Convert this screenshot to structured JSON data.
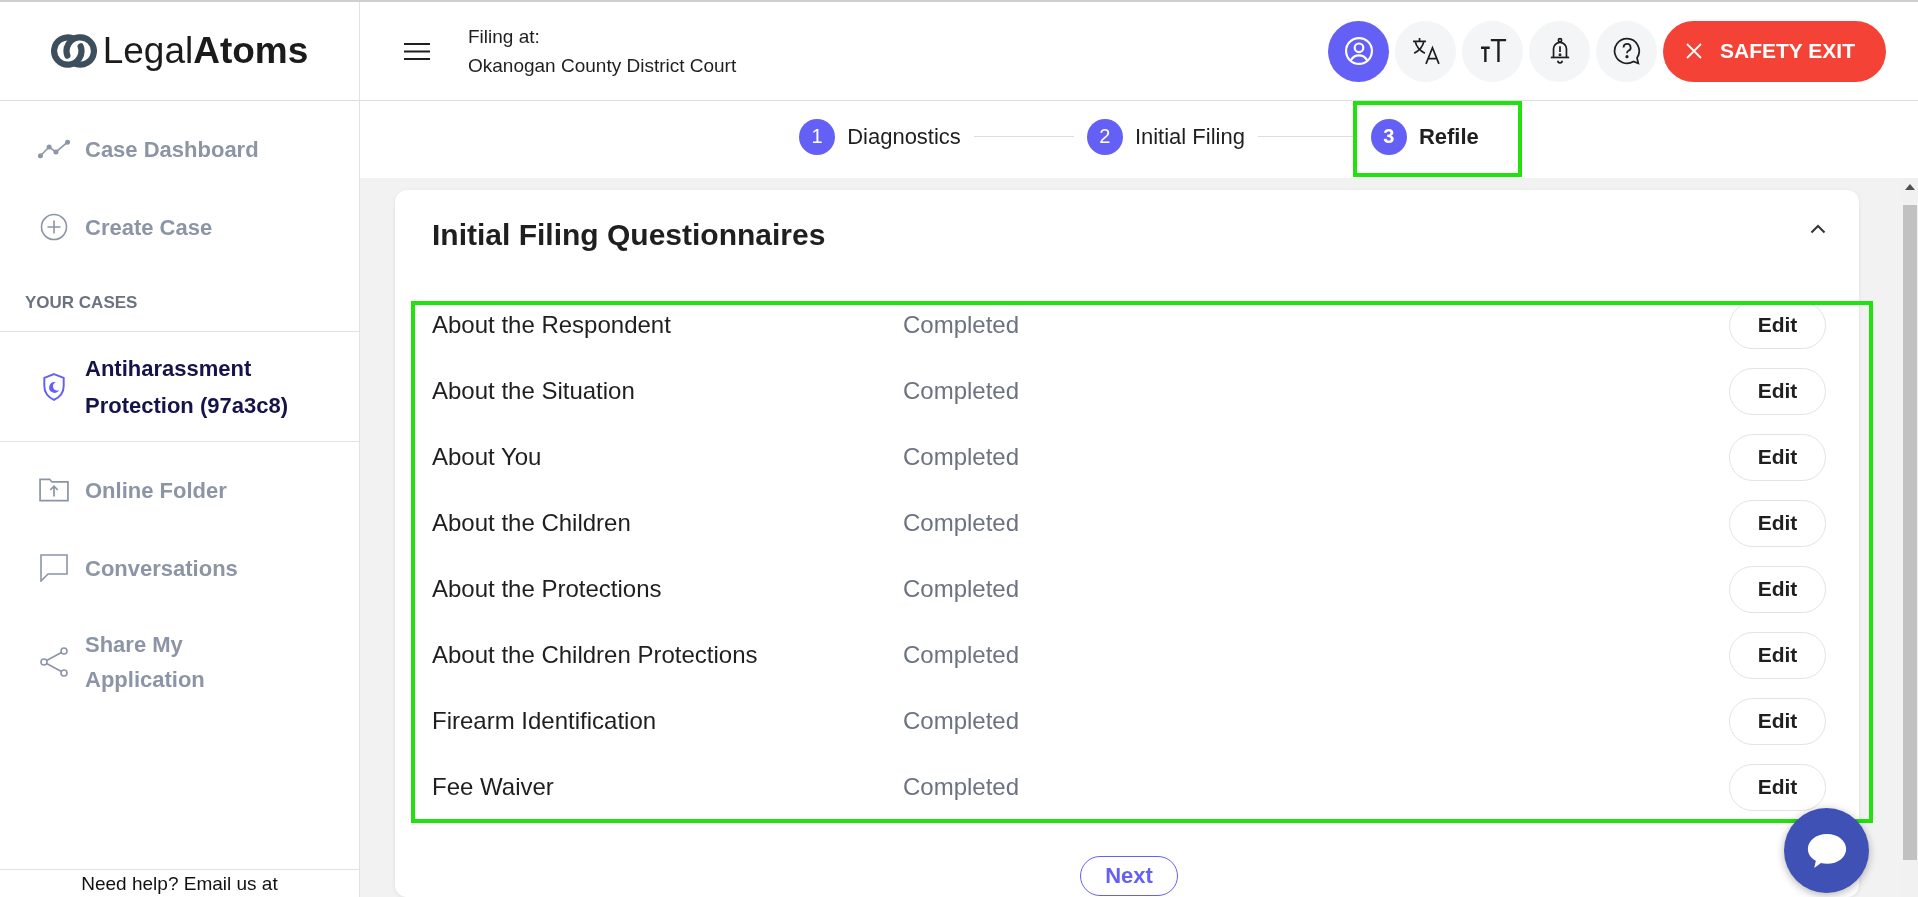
{
  "logo": {
    "text": "Legal**Atoms**"
  },
  "sidebar": {
    "nav": [
      {
        "kind": "dashboard",
        "label": "Case Dashboard"
      },
      {
        "kind": "create",
        "label": "Create Case"
      }
    ],
    "cases_heading": "YOUR CASES",
    "cases": [
      {
        "label": "Antiharassment Protection (97a3c8)",
        "selected": true
      }
    ],
    "links": [
      {
        "kind": "folder",
        "label": "Online Folder"
      },
      {
        "kind": "conversations",
        "label": "Conversations"
      },
      {
        "kind": "share",
        "label": "Share My Application"
      }
    ],
    "help_text": "Need help? Email us at"
  },
  "header": {
    "filing_label": "Filing at:",
    "court": "Okanogan County District Court",
    "icon_buttons": [
      {
        "kind": "account",
        "selected": true
      },
      {
        "kind": "translate",
        "selected": false
      },
      {
        "kind": "text_size",
        "selected": false
      },
      {
        "kind": "notifications",
        "selected": false
      },
      {
        "kind": "help",
        "selected": false
      }
    ],
    "exit_button": "SAFETY EXIT"
  },
  "stepper": {
    "steps": [
      {
        "number": "1",
        "label": "Diagnostics",
        "selected": false,
        "highlighted": false
      },
      {
        "number": "2",
        "label": "Initial Filing",
        "selected": false,
        "highlighted": false
      },
      {
        "number": "3",
        "label": "Refile",
        "selected": true,
        "highlighted": true
      }
    ]
  },
  "questionnaires": {
    "title": "Initial Filing Questionnaires",
    "expanded": true,
    "highlighted": true,
    "rows": [
      {
        "name": "About the Respondent",
        "status": "Completed",
        "action": "Edit"
      },
      {
        "name": "About the Situation",
        "status": "Completed",
        "action": "Edit"
      },
      {
        "name": "About You",
        "status": "Completed",
        "action": "Edit"
      },
      {
        "name": "About the Children",
        "status": "Completed",
        "action": "Edit"
      },
      {
        "name": "About the Protections",
        "status": "Completed",
        "action": "Edit"
      },
      {
        "name": "About the Children Protections",
        "status": "Completed",
        "action": "Edit"
      },
      {
        "name": "Firearm Identification",
        "status": "Completed",
        "action": "Edit"
      },
      {
        "name": "Fee Waiver",
        "status": "Completed",
        "action": "Edit"
      }
    ]
  },
  "next_button": "Next"
}
